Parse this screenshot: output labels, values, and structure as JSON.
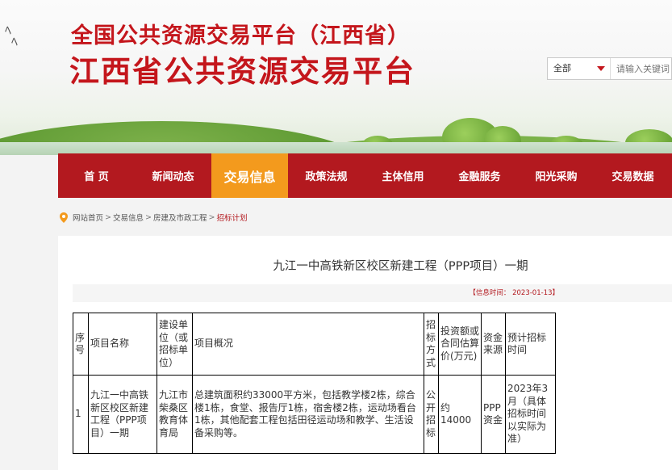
{
  "header": {
    "title_small": "全国公共资源交易平台（江西省）",
    "title_big": "江西省公共资源交易平台"
  },
  "search": {
    "scope_selected": "全部",
    "placeholder": "请输入关键词"
  },
  "nav": {
    "items": [
      {
        "label": "首 页"
      },
      {
        "label": "新闻动态"
      },
      {
        "label": "交易信息"
      },
      {
        "label": "政策法规"
      },
      {
        "label": "主体信用"
      },
      {
        "label": "金融服务"
      },
      {
        "label": "阳光采购"
      },
      {
        "label": "交易数据"
      }
    ],
    "active_index": 2
  },
  "breadcrumb": {
    "items": [
      "网站首页",
      "交易信息",
      "房建及市政工程",
      "招标计划"
    ],
    "separator": ">"
  },
  "article": {
    "title": "九江一中高铁新区校区新建工程（PPP项目）一期",
    "info_time": "【信息时间： 2023-01-13】"
  },
  "table": {
    "headers": [
      "序号",
      "项目名称",
      "建设单位（或招标单位）",
      "项目概况",
      "招标方式",
      "投资额或合同估算价(万元)",
      "资金来源",
      "预计招标时间"
    ],
    "rows": [
      [
        "1",
        "九江一中高铁新区校区新建工程（PPP项目）一期",
        "九江市柴桑区教育体育局",
        "总建筑面积约33000平方米，包括教学楼2栋，综合楼1栋，食堂、报告厅1栋，宿舍楼2栋，运动场看台1栋，其他配套工程包括田径运动场和教学、生活设备采购等。",
        "公开招标",
        "约14000",
        "PPP资金",
        "2023年3月（具体招标时间以实际为准）"
      ]
    ]
  },
  "colors": {
    "brand_red": "#b3191f",
    "title_red": "#c4161c",
    "active_orange": "#f39a1d"
  }
}
